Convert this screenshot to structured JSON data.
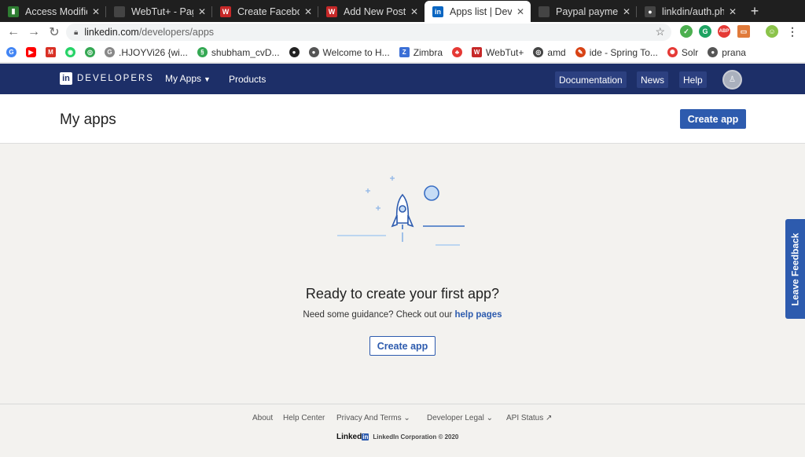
{
  "browser": {
    "tabs": [
      {
        "label": "Access Modifier",
        "favicon_color": "#2e7d32"
      },
      {
        "label": "WebTut+ - Page",
        "favicon_color": "#444444"
      },
      {
        "label": "Create Facebook",
        "favicon_color": "#c62828"
      },
      {
        "label": "Add New Post",
        "favicon_color": "#c62828"
      },
      {
        "label": "Apps list | Devel",
        "favicon_color": "#0a66c2"
      },
      {
        "label": "Paypal payment",
        "favicon_color": "#444444"
      },
      {
        "label": "linkdin/auth.ph",
        "favicon_color": "#444444"
      }
    ],
    "new_tab": "+",
    "url_host": "linkedin.com",
    "url_path": "/developers/apps",
    "bookmarks": [
      {
        "label": "",
        "color": "#4285f4",
        "glyph": "G"
      },
      {
        "label": "",
        "color": "#ff0000",
        "glyph": "▶"
      },
      {
        "label": "",
        "color": "#d93025",
        "glyph": "M"
      },
      {
        "label": "",
        "color": "#25d366",
        "glyph": "◉"
      },
      {
        "label": "",
        "color": "#34a853",
        "glyph": "◎"
      },
      {
        "label": ".HJOYVi26 {wi...",
        "color": "#888888",
        "glyph": "G"
      },
      {
        "label": "shubham_cvD...",
        "color": "#34a853",
        "glyph": "§"
      },
      {
        "label": "",
        "color": "#222222",
        "glyph": "●"
      },
      {
        "label": "Welcome to H...",
        "color": "#555555",
        "glyph": "●"
      },
      {
        "label": "Zimbra",
        "color": "#3b6fd6",
        "glyph": "Z"
      },
      {
        "label": "",
        "color": "#e53935",
        "glyph": "♣"
      },
      {
        "label": "WebTut+",
        "color": "#c62828",
        "glyph": "W"
      },
      {
        "label": "amd",
        "color": "#444444",
        "glyph": "◎"
      },
      {
        "label": "ide - Spring To...",
        "color": "#d84315",
        "glyph": "✎"
      },
      {
        "label": "Solr",
        "color": "#e53935",
        "glyph": "✺"
      },
      {
        "label": "prana",
        "color": "#555555",
        "glyph": "●"
      }
    ]
  },
  "header": {
    "logo_mark": "in",
    "logo_text": "DEVELOPERS",
    "my_apps": "My Apps",
    "products": "Products",
    "documentation": "Documentation",
    "news": "News",
    "help": "Help"
  },
  "page": {
    "title": "My apps",
    "create_app": "Create app"
  },
  "empty_state": {
    "title": "Ready to create your first app?",
    "subtitle": "Need some guidance? Check out our",
    "link": "help pages",
    "button": "Create app"
  },
  "feedback": "Leave Feedback",
  "footer": {
    "links": [
      "About",
      "Help Center",
      "Privacy And Terms",
      "Developer Legal",
      "API Status"
    ],
    "brand": "Linked",
    "brand_in": "in",
    "copyright": "LinkedIn Corporation © 2020"
  },
  "colors": {
    "nav_bg": "#1d2f68",
    "accent": "#2d5bae",
    "page_bg": "#f3f2ef"
  }
}
